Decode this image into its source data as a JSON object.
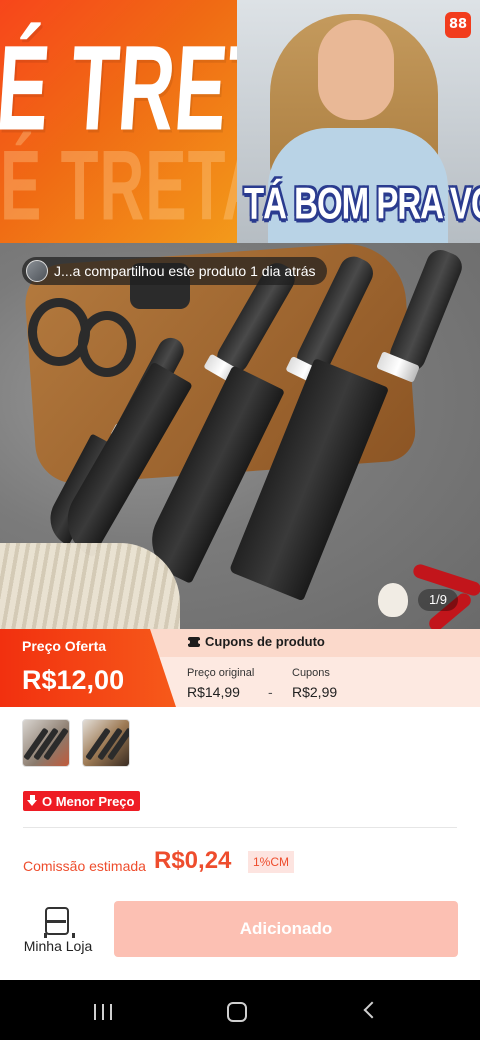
{
  "banner": {
    "left_text": "É TRETA!",
    "ghost_text": "É TRETA",
    "caption": "TÁ BOM PRA VOCÊ?",
    "app_badge": "88"
  },
  "product": {
    "shared_text": "J...a compartilhou este produto 1 dia atrás",
    "image_counter": "1/9"
  },
  "price": {
    "offer_label": "Preço Oferta",
    "offer_value": "R$12,00",
    "coupons_title": "Cupons de produto",
    "original_label": "Preço original",
    "original_value": "R$14,99",
    "separator": "-",
    "coupons_label": "Cupons",
    "coupons_value": "R$2,99"
  },
  "badges": {
    "lowest_price": "O Menor Preço"
  },
  "commission": {
    "label": "Comissão estimada",
    "value": "R$0,24",
    "rate": "1%CM"
  },
  "actions": {
    "store_label": "Minha Loja",
    "added_label": "Adicionado"
  },
  "colors": {
    "accent": "#ee4d2d",
    "offer_gradient_start": "#f2300f",
    "button_disabled": "#fcc0b3"
  }
}
